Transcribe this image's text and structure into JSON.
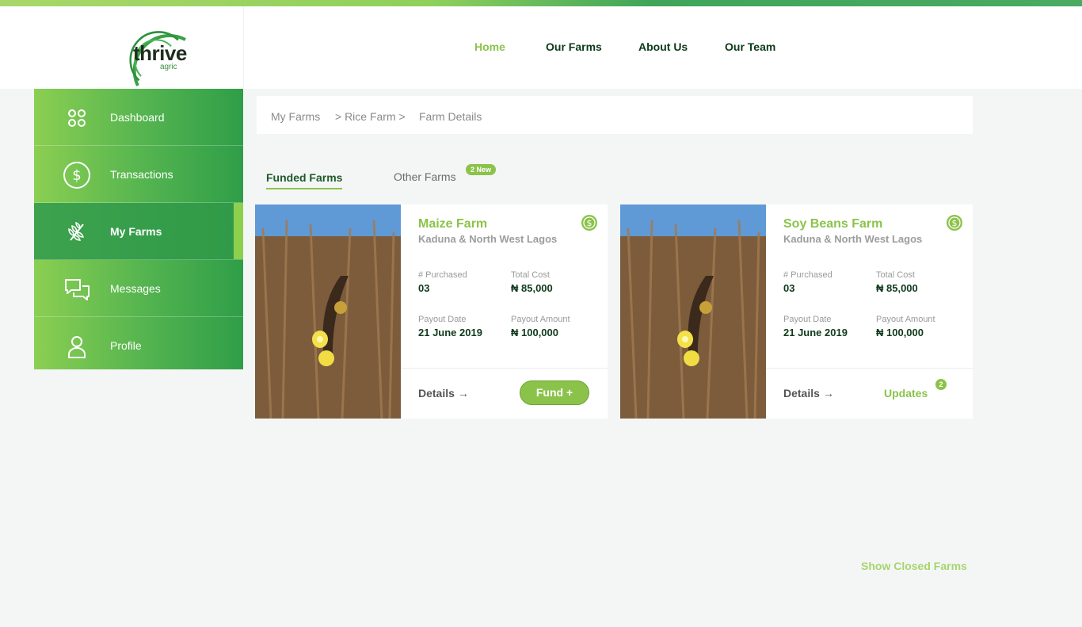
{
  "brand": {
    "name": "thrive",
    "sub": "agric"
  },
  "nav": [
    {
      "label": "Home",
      "active": true
    },
    {
      "label": "Our Farms",
      "active": false
    },
    {
      "label": "About Us",
      "active": false
    },
    {
      "label": "Our Team",
      "active": false
    }
  ],
  "sidebar": [
    {
      "label": "Dashboard",
      "icon": "dashboard-icon"
    },
    {
      "label": "Transactions",
      "icon": "dollar-circle-icon"
    },
    {
      "label": "My Farms",
      "icon": "wheat-icon",
      "active": true
    },
    {
      "label": "Messages",
      "icon": "chat-icon"
    },
    {
      "label": "Profile",
      "icon": "user-icon"
    }
  ],
  "breadcrumb": {
    "a": "My Farms",
    "b": "> Rice Farm >",
    "c": "Farm Details"
  },
  "tabs": {
    "funded": "Funded Farms",
    "other": "Other Farms",
    "other_badge": "2 New"
  },
  "cards": [
    {
      "title": "Maize Farm",
      "location": "Kaduna & North West Lagos",
      "purchased_label": "# Purchased",
      "purchased": "03",
      "total_cost_label": "Total Cost",
      "total_cost": "₦ 85,000",
      "payout_date_label": "Payout Date",
      "payout_date": "21 June 2019",
      "payout_amount_label": "Payout Amount",
      "payout_amount": "₦ 100,000",
      "details": "Details",
      "action": "Fund +"
    },
    {
      "title": "Soy Beans Farm",
      "location": "Kaduna & North West Lagos",
      "purchased_label": "# Purchased",
      "purchased": "03",
      "total_cost_label": "Total Cost",
      "total_cost": "₦ 85,000",
      "payout_date_label": "Payout Date",
      "payout_date": "21 June 2019",
      "payout_amount_label": "Payout Amount",
      "payout_amount": "₦ 100,000",
      "details": "Details",
      "action": "Updates",
      "updates_count": "2"
    }
  ],
  "show_closed": "Show Closed Farms",
  "colors": {
    "accent": "#8bc34a",
    "dark_green": "#0f3a1c",
    "sidebar_green": "#3da24e"
  }
}
